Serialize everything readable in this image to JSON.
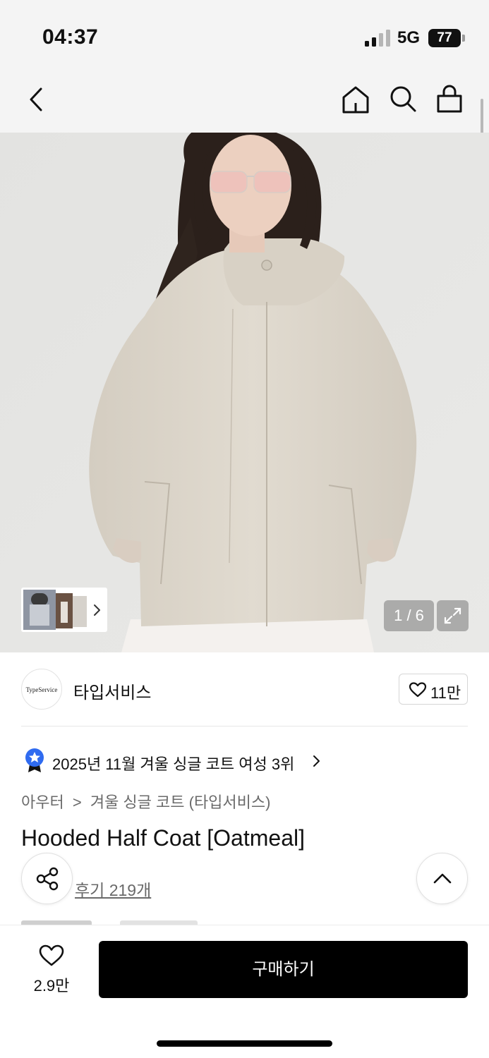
{
  "status_bar": {
    "time": "04:37",
    "network": "5G",
    "battery": "77",
    "icons": [
      "signal-icon",
      "battery-icon"
    ]
  },
  "nav": {
    "icons": [
      "back-icon",
      "home-icon",
      "search-icon",
      "cart-icon"
    ]
  },
  "gallery": {
    "counter": "1 / 6",
    "icons": [
      "chevron-right-icon",
      "expand-icon"
    ],
    "colors": {
      "coat": "#dcd6cb",
      "background": "#e6e6e4",
      "skirt": "#f2efec",
      "hair": "#2b201b"
    }
  },
  "brand": {
    "logo_text": "TypeService",
    "name": "타입서비스",
    "like_count": "11만",
    "icons": [
      "heart-outline-icon"
    ]
  },
  "ranking": {
    "text": "2025년 11월 겨울 싱글 코트 여성 3위",
    "icons": [
      "ranking-star-badge-icon",
      "chevron-right-icon"
    ],
    "badge_color": "#2f6bf0"
  },
  "category": {
    "level1": "아우터",
    "separator": ">",
    "level2": "겨울 싱글 코트 (타입서비스)"
  },
  "product": {
    "title": "Hooded Half Coat [Oatmeal]",
    "review_link": "후기 219개"
  },
  "floating": {
    "icons": [
      "share-icon",
      "chevron-up-icon"
    ]
  },
  "bottom_bar": {
    "wish_count": "2.9만",
    "buy_label": "구매하기",
    "icons": [
      "heart-outline-icon"
    ]
  }
}
